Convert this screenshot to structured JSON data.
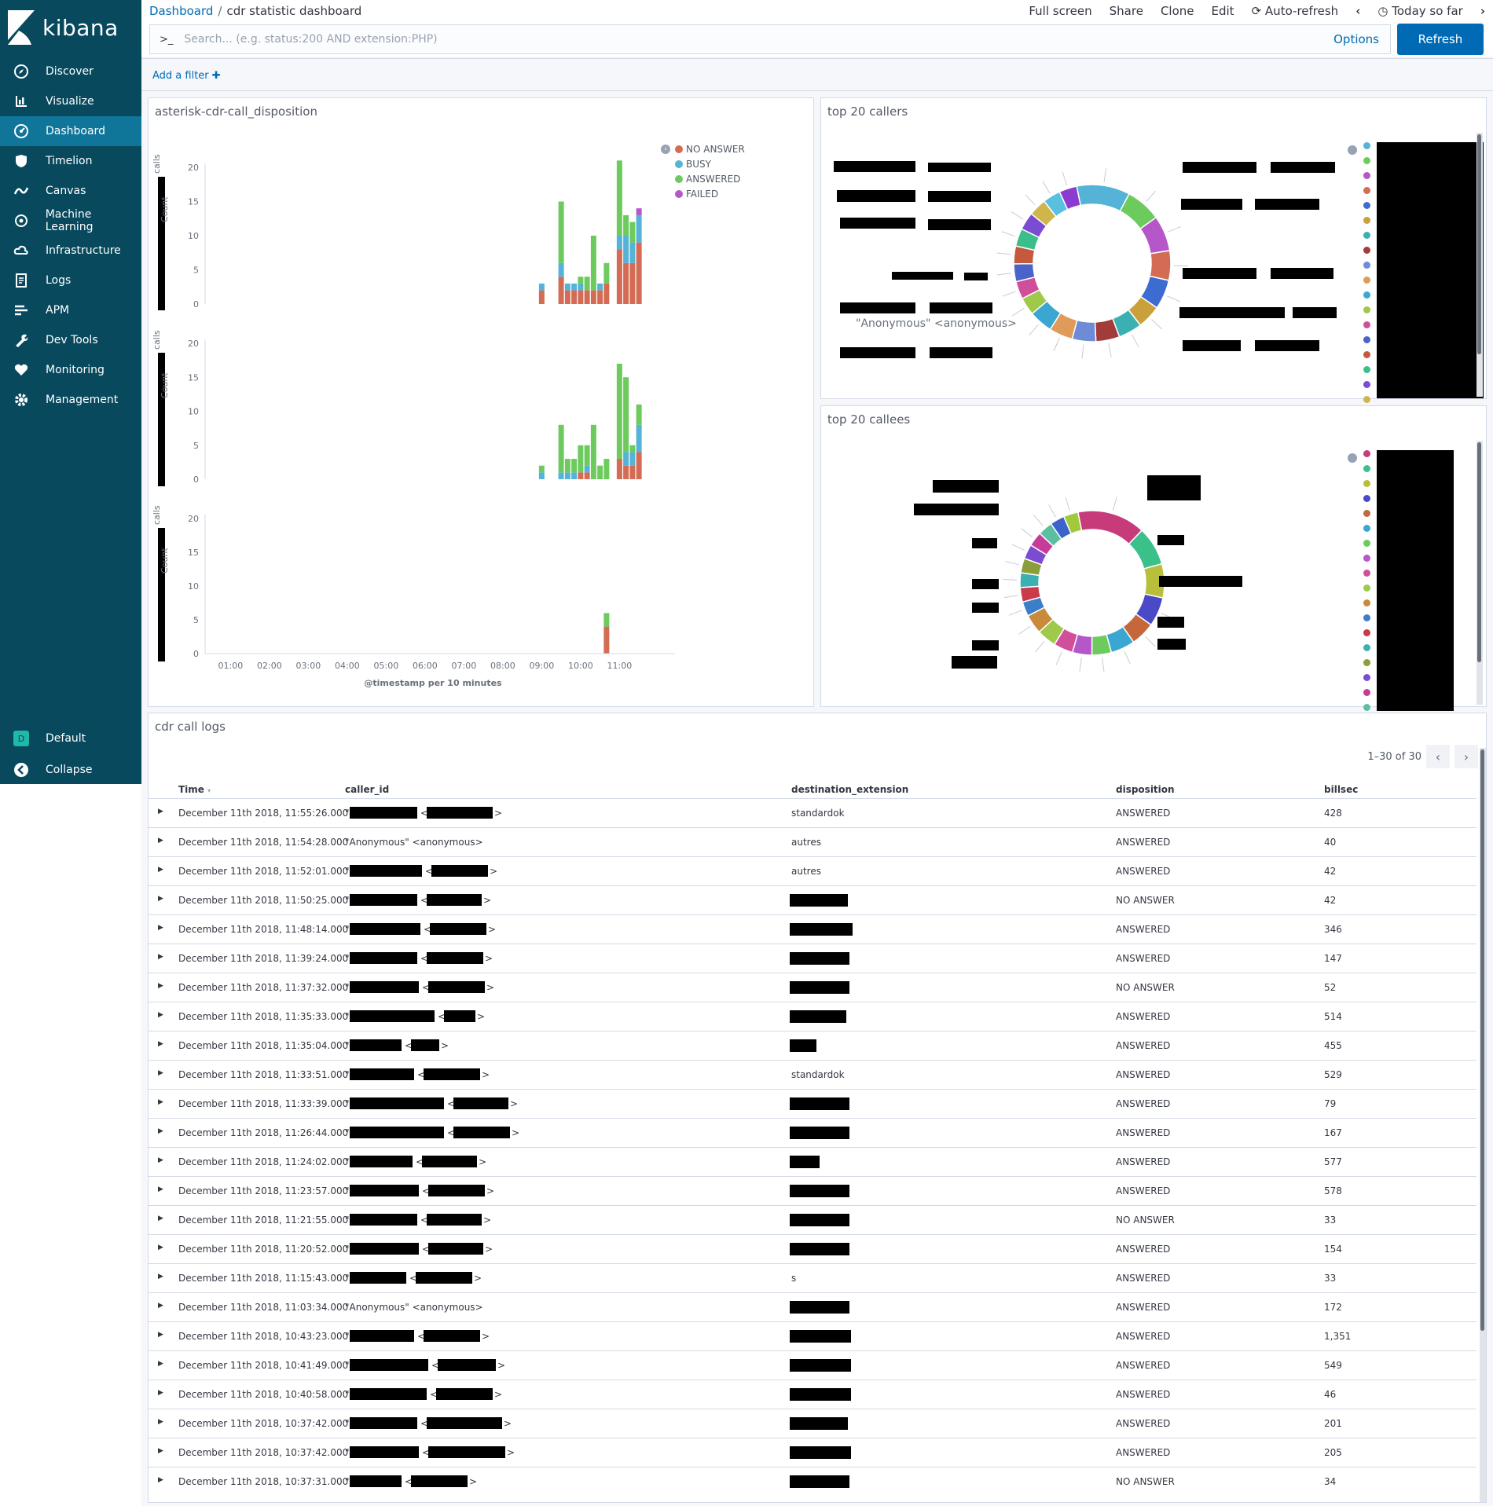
{
  "app": {
    "name": "kibana"
  },
  "nav": {
    "items": [
      {
        "label": "Discover",
        "icon": "compass-icon"
      },
      {
        "label": "Visualize",
        "icon": "bar-chart-icon"
      },
      {
        "label": "Dashboard",
        "icon": "dashboard-icon",
        "active": true
      },
      {
        "label": "Timelion",
        "icon": "shield-icon"
      },
      {
        "label": "Canvas",
        "icon": "canvas-icon"
      },
      {
        "label": "Machine Learning",
        "icon": "ml-icon"
      },
      {
        "label": "Infrastructure",
        "icon": "cloud-icon"
      },
      {
        "label": "Logs",
        "icon": "logs-icon"
      },
      {
        "label": "APM",
        "icon": "apm-icon"
      },
      {
        "label": "Dev Tools",
        "icon": "wrench-icon"
      },
      {
        "label": "Monitoring",
        "icon": "heartbeat-icon"
      },
      {
        "label": "Management",
        "icon": "gear-icon"
      }
    ],
    "space": {
      "badge": "D",
      "label": "Default"
    },
    "collapse": "Collapse"
  },
  "breadcrumb": {
    "root": "Dashboard",
    "current": "cdr statistic dashboard"
  },
  "topmenu": {
    "fullscreen": "Full screen",
    "share": "Share",
    "clone": "Clone",
    "edit": "Edit",
    "autorefresh": "Auto-refresh",
    "timerange": "Today so far"
  },
  "search": {
    "prompt": ">_",
    "placeholder": "Search... (e.g. status:200 AND extension:PHP)",
    "options": "Options",
    "refresh": "Refresh"
  },
  "filters": {
    "add": "Add a filter"
  },
  "panels": {
    "disposition": {
      "title": "asterisk-cdr-call_disposition"
    },
    "callers": {
      "title": "top 20 callers",
      "anonymous_label": "\"Anonymous\" <anonymous>"
    },
    "callees": {
      "title": "top 20 callees"
    },
    "logs": {
      "title": "cdr call logs",
      "pager": "1–30 of 30"
    }
  },
  "colors": {
    "no_answer": "#d36b55",
    "busy": "#54b3d6",
    "answered": "#6dcb5e",
    "failed": "#b556c9",
    "sidebar": "#08495e",
    "accent": "#006bb4"
  },
  "chart_data": {
    "type": "bar",
    "xlabel": "@timestamp per 10 minutes",
    "ylabel": "Count",
    "ylim": [
      0,
      20
    ],
    "yticks": [
      0,
      5,
      10,
      15,
      20
    ],
    "legend": {
      "placement": "top-right"
    },
    "x_ticks": [
      "01:00",
      "02:00",
      "03:00",
      "04:00",
      "05:00",
      "06:00",
      "07:00",
      "08:00",
      "09:00",
      "10:00",
      "11:00"
    ],
    "series_names": [
      "NO ANSWER",
      "BUSY",
      "ANSWERED",
      "FAILED"
    ],
    "panels": [
      {
        "ylabel_small": "calls",
        "bars": [
          {
            "x": "09:00",
            "NO ANSWER": 2,
            "BUSY": 1,
            "ANSWERED": 0,
            "FAILED": 0
          },
          {
            "x": "09:30",
            "NO ANSWER": 4,
            "BUSY": 2,
            "ANSWERED": 9,
            "FAILED": 0
          },
          {
            "x": "09:40",
            "NO ANSWER": 2,
            "BUSY": 1,
            "ANSWERED": 0,
            "FAILED": 0
          },
          {
            "x": "09:50",
            "NO ANSWER": 2,
            "BUSY": 1,
            "ANSWERED": 0,
            "FAILED": 0
          },
          {
            "x": "10:00",
            "NO ANSWER": 2,
            "BUSY": 1,
            "ANSWERED": 1,
            "FAILED": 0
          },
          {
            "x": "10:10",
            "NO ANSWER": 2,
            "BUSY": 0,
            "ANSWERED": 2,
            "FAILED": 0
          },
          {
            "x": "10:20",
            "NO ANSWER": 2,
            "BUSY": 0,
            "ANSWERED": 8,
            "FAILED": 0
          },
          {
            "x": "10:30",
            "NO ANSWER": 2,
            "BUSY": 1,
            "ANSWERED": 0,
            "FAILED": 0
          },
          {
            "x": "10:40",
            "NO ANSWER": 3,
            "BUSY": 0,
            "ANSWERED": 3,
            "FAILED": 0
          },
          {
            "x": "11:00",
            "NO ANSWER": 8,
            "BUSY": 2,
            "ANSWERED": 11,
            "FAILED": 0
          },
          {
            "x": "11:10",
            "NO ANSWER": 6,
            "BUSY": 4,
            "ANSWERED": 3,
            "FAILED": 0
          },
          {
            "x": "11:20",
            "NO ANSWER": 6,
            "BUSY": 3,
            "ANSWERED": 3,
            "FAILED": 0
          },
          {
            "x": "11:30",
            "NO ANSWER": 9,
            "BUSY": 4,
            "ANSWERED": 0,
            "FAILED": 1
          }
        ]
      },
      {
        "ylabel_small": "calls",
        "bars": [
          {
            "x": "09:00",
            "NO ANSWER": 0,
            "BUSY": 1,
            "ANSWERED": 1,
            "FAILED": 0
          },
          {
            "x": "09:30",
            "NO ANSWER": 0,
            "BUSY": 1,
            "ANSWERED": 7,
            "FAILED": 0
          },
          {
            "x": "09:40",
            "NO ANSWER": 0,
            "BUSY": 1,
            "ANSWERED": 2,
            "FAILED": 0
          },
          {
            "x": "09:50",
            "NO ANSWER": 0,
            "BUSY": 1,
            "ANSWERED": 2,
            "FAILED": 0
          },
          {
            "x": "10:00",
            "NO ANSWER": 1,
            "BUSY": 0,
            "ANSWERED": 4,
            "FAILED": 0
          },
          {
            "x": "10:10",
            "NO ANSWER": 1,
            "BUSY": 1,
            "ANSWERED": 3,
            "FAILED": 0
          },
          {
            "x": "10:20",
            "NO ANSWER": 0,
            "BUSY": 0,
            "ANSWERED": 8,
            "FAILED": 0
          },
          {
            "x": "10:30",
            "NO ANSWER": 0,
            "BUSY": 0,
            "ANSWERED": 2,
            "FAILED": 0
          },
          {
            "x": "10:40",
            "NO ANSWER": 0,
            "BUSY": 0,
            "ANSWERED": 3,
            "FAILED": 0
          },
          {
            "x": "11:00",
            "NO ANSWER": 3,
            "BUSY": 0,
            "ANSWERED": 14,
            "FAILED": 0
          },
          {
            "x": "11:10",
            "NO ANSWER": 2,
            "BUSY": 2,
            "ANSWERED": 11,
            "FAILED": 0
          },
          {
            "x": "11:20",
            "NO ANSWER": 2,
            "BUSY": 2,
            "ANSWERED": 1,
            "FAILED": 0
          },
          {
            "x": "11:30",
            "NO ANSWER": 4,
            "BUSY": 4,
            "ANSWERED": 3,
            "FAILED": 0
          }
        ]
      },
      {
        "ylabel_small": "calls",
        "bars": [
          {
            "x": "10:40",
            "NO ANSWER": 4,
            "BUSY": 0,
            "ANSWERED": 2,
            "FAILED": 0
          }
        ]
      }
    ]
  },
  "callers_pie": {
    "colors": [
      "#54b3d6",
      "#6dcb5e",
      "#b556c9",
      "#d36b55",
      "#3c6cd0",
      "#c9a03a",
      "#3bb0b3",
      "#a33b3b",
      "#6d8bd6",
      "#e09a5a",
      "#3ba6d1",
      "#9ec94a",
      "#d14f9a",
      "#4a63c9",
      "#c45a3b",
      "#3bbf8a",
      "#7b4cd1",
      "#cfb54a",
      "#5ac0e0",
      "#8c3bd1"
    ],
    "values": [
      9,
      6,
      6,
      5,
      5,
      4,
      4,
      4,
      4,
      4,
      4,
      3,
      3,
      3,
      3,
      3,
      3,
      3,
      3,
      3
    ]
  },
  "callees_pie": {
    "colors": [
      "#c73b7b",
      "#3bc08a",
      "#b8bf3b",
      "#4a4ac9",
      "#c4683b",
      "#3ba6d1",
      "#6dcb5e",
      "#b556c9",
      "#d14f9a",
      "#9ec94a",
      "#c98a3b",
      "#3b7ec9",
      "#c93b4a",
      "#3bb0b3",
      "#8c9e3b",
      "#7b4cd1",
      "#c73b9a",
      "#5ac0a0",
      "#3b63c9",
      "#a0c93b"
    ],
    "values": [
      14,
      8,
      7,
      6,
      5,
      5,
      4,
      4,
      4,
      4,
      4,
      3,
      3,
      3,
      3,
      3,
      3,
      3,
      3,
      3
    ]
  },
  "table": {
    "headers": {
      "time": "Time",
      "caller": "caller_id",
      "dest": "destination_extension",
      "disp": "disposition",
      "bill": "billsec"
    },
    "rows": [
      {
        "time": "December 11th 2018, 11:55:26.000",
        "dest": "standardok",
        "disp": "ANSWERED",
        "bill": "428"
      },
      {
        "time": "December 11th 2018, 11:54:28.000",
        "caller": "\"Anonymous\" <anonymous>",
        "dest": "autres",
        "disp": "ANSWERED",
        "bill": "40"
      },
      {
        "time": "December 11th 2018, 11:52:01.000",
        "dest": "autres",
        "disp": "ANSWERED",
        "bill": "42"
      },
      {
        "time": "December 11th 2018, 11:50:25.000",
        "disp": "NO ANSWER",
        "bill": "42"
      },
      {
        "time": "December 11th 2018, 11:48:14.000",
        "disp": "ANSWERED",
        "bill": "346"
      },
      {
        "time": "December 11th 2018, 11:39:24.000",
        "disp": "ANSWERED",
        "bill": "147"
      },
      {
        "time": "December 11th 2018, 11:37:32.000",
        "disp": "NO ANSWER",
        "bill": "52"
      },
      {
        "time": "December 11th 2018, 11:35:33.000",
        "disp": "ANSWERED",
        "bill": "514"
      },
      {
        "time": "December 11th 2018, 11:35:04.000",
        "disp": "ANSWERED",
        "bill": "455"
      },
      {
        "time": "December 11th 2018, 11:33:51.000",
        "dest": "standardok",
        "disp": "ANSWERED",
        "bill": "529"
      },
      {
        "time": "December 11th 2018, 11:33:39.000",
        "disp": "ANSWERED",
        "bill": "79"
      },
      {
        "time": "December 11th 2018, 11:26:44.000",
        "disp": "ANSWERED",
        "bill": "167"
      },
      {
        "time": "December 11th 2018, 11:24:02.000",
        "disp": "ANSWERED",
        "bill": "577"
      },
      {
        "time": "December 11th 2018, 11:23:57.000",
        "disp": "ANSWERED",
        "bill": "578"
      },
      {
        "time": "December 11th 2018, 11:21:55.000",
        "disp": "NO ANSWER",
        "bill": "33"
      },
      {
        "time": "December 11th 2018, 11:20:52.000",
        "disp": "ANSWERED",
        "bill": "154"
      },
      {
        "time": "December 11th 2018, 11:15:43.000",
        "dest": "s",
        "disp": "ANSWERED",
        "bill": "33"
      },
      {
        "time": "December 11th 2018, 11:03:34.000",
        "caller": "\"Anonymous\" <anonymous>",
        "disp": "ANSWERED",
        "bill": "172"
      },
      {
        "time": "December 11th 2018, 10:43:23.000",
        "disp": "ANSWERED",
        "bill": "1,351"
      },
      {
        "time": "December 11th 2018, 10:41:49.000",
        "disp": "ANSWERED",
        "bill": "549"
      },
      {
        "time": "December 11th 2018, 10:40:58.000",
        "disp": "ANSWERED",
        "bill": "46"
      },
      {
        "time": "December 11th 2018, 10:37:42.000",
        "disp": "ANSWERED",
        "bill": "201"
      },
      {
        "time": "December 11th 2018, 10:37:42.000",
        "disp": "ANSWERED",
        "bill": "205"
      },
      {
        "time": "December 11th 2018, 10:37:31.000",
        "disp": "NO ANSWER",
        "bill": "34"
      }
    ]
  }
}
